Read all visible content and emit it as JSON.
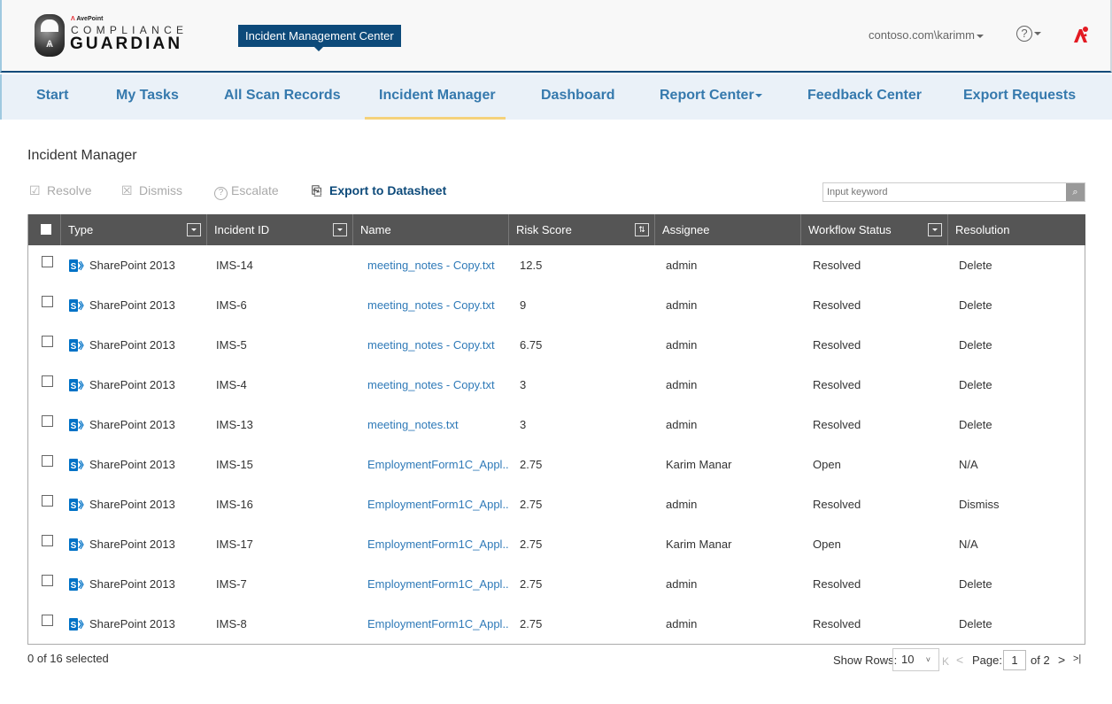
{
  "header": {
    "logo": {
      "vendor": "AvePoint",
      "line1": "COMPLIANCE",
      "line2": "GUARDIAN",
      "lock_figure": "Ѧ"
    },
    "badge": "Incident Management Center",
    "user": "contoso.com\\karimm",
    "help_glyph": "?",
    "brand_color": "#e31b23"
  },
  "nav": {
    "items": [
      {
        "label": "Start"
      },
      {
        "label": "My Tasks"
      },
      {
        "label": "All Scan Records"
      },
      {
        "label": "Incident Manager",
        "active": true
      },
      {
        "label": "Dashboard"
      },
      {
        "label": "Report Center",
        "dropdown": true
      },
      {
        "label": "Feedback Center"
      },
      {
        "label": "Export Requests"
      }
    ]
  },
  "page": {
    "title": "Incident Manager"
  },
  "toolbar": {
    "resolve": {
      "label": "Resolve",
      "icon": "resolve-check-icon",
      "glyph": "☑"
    },
    "dismiss": {
      "label": "Dismiss",
      "icon": "dismiss-x-icon",
      "glyph": "☒"
    },
    "escalate": {
      "label": "Escalate",
      "icon": "escalate-question-icon",
      "glyph": "?"
    },
    "export": {
      "label": "Export to Datasheet",
      "icon": "datasheet-export-icon",
      "glyph": "⎘"
    }
  },
  "search": {
    "placeholder": "Input keyword",
    "value": "",
    "button_glyph": "⌕"
  },
  "table": {
    "columns": [
      {
        "key": "type",
        "label": "Type",
        "control": "filter"
      },
      {
        "key": "id",
        "label": "Incident ID",
        "control": "filter"
      },
      {
        "key": "name",
        "label": "Name"
      },
      {
        "key": "risk",
        "label": "Risk Score",
        "control": "sort",
        "sort_glyph": "⇅"
      },
      {
        "key": "assignee",
        "label": "Assignee"
      },
      {
        "key": "status",
        "label": "Workflow Status",
        "control": "filter"
      },
      {
        "key": "resolution",
        "label": "Resolution"
      }
    ],
    "rows": [
      {
        "type": "SharePoint 2013",
        "id": "IMS-14",
        "name": "meeting_notes - Copy.txt",
        "risk": "12.5",
        "assignee": "admin",
        "status": "Resolved",
        "resolution": "Delete"
      },
      {
        "type": "SharePoint 2013",
        "id": "IMS-6",
        "name": "meeting_notes - Copy.txt",
        "risk": "9",
        "assignee": "admin",
        "status": "Resolved",
        "resolution": "Delete"
      },
      {
        "type": "SharePoint 2013",
        "id": "IMS-5",
        "name": "meeting_notes - Copy.txt",
        "risk": "6.75",
        "assignee": "admin",
        "status": "Resolved",
        "resolution": "Delete"
      },
      {
        "type": "SharePoint 2013",
        "id": "IMS-4",
        "name": "meeting_notes - Copy.txt",
        "risk": "3",
        "assignee": "admin",
        "status": "Resolved",
        "resolution": "Delete"
      },
      {
        "type": "SharePoint 2013",
        "id": "IMS-13",
        "name": "meeting_notes.txt",
        "risk": "3",
        "assignee": "admin",
        "status": "Resolved",
        "resolution": "Delete"
      },
      {
        "type": "SharePoint 2013",
        "id": "IMS-15",
        "name": "EmploymentForm1C_Appl...",
        "risk": "2.75",
        "assignee": "Karim Manar",
        "status": "Open",
        "resolution": "N/A"
      },
      {
        "type": "SharePoint 2013",
        "id": "IMS-16",
        "name": "EmploymentForm1C_Appl...",
        "risk": "2.75",
        "assignee": "admin",
        "status": "Resolved",
        "resolution": "Dismiss"
      },
      {
        "type": "SharePoint 2013",
        "id": "IMS-17",
        "name": "EmploymentForm1C_Appl...",
        "risk": "2.75",
        "assignee": "Karim Manar",
        "status": "Open",
        "resolution": "N/A"
      },
      {
        "type": "SharePoint 2013",
        "id": "IMS-7",
        "name": "EmploymentForm1C_Appl...",
        "risk": "2.75",
        "assignee": "admin",
        "status": "Resolved",
        "resolution": "Delete"
      },
      {
        "type": "SharePoint 2013",
        "id": "IMS-8",
        "name": "EmploymentForm1C_Appl...",
        "risk": "2.75",
        "assignee": "admin",
        "status": "Resolved",
        "resolution": "Delete"
      }
    ]
  },
  "footer": {
    "selected": "0 of 16 selected",
    "show_rows_label": "Show Rows:",
    "rows_per_page": "10",
    "rows_chevron": "˅",
    "first_glyph": "K",
    "prev_glyph": "<",
    "page_label": "Page:",
    "current_page": "1",
    "of_total": "of 2",
    "next_glyph": ">",
    "last_glyph": ">|"
  },
  "colors": {
    "header_blue": "#0d4a7a",
    "nav_bg": "#eaf1f8",
    "nav_text": "#3579ad",
    "active_underline": "#f5d27a",
    "table_header": "#555555",
    "link": "#2f7ab8",
    "sharepoint": "#0072c6"
  }
}
